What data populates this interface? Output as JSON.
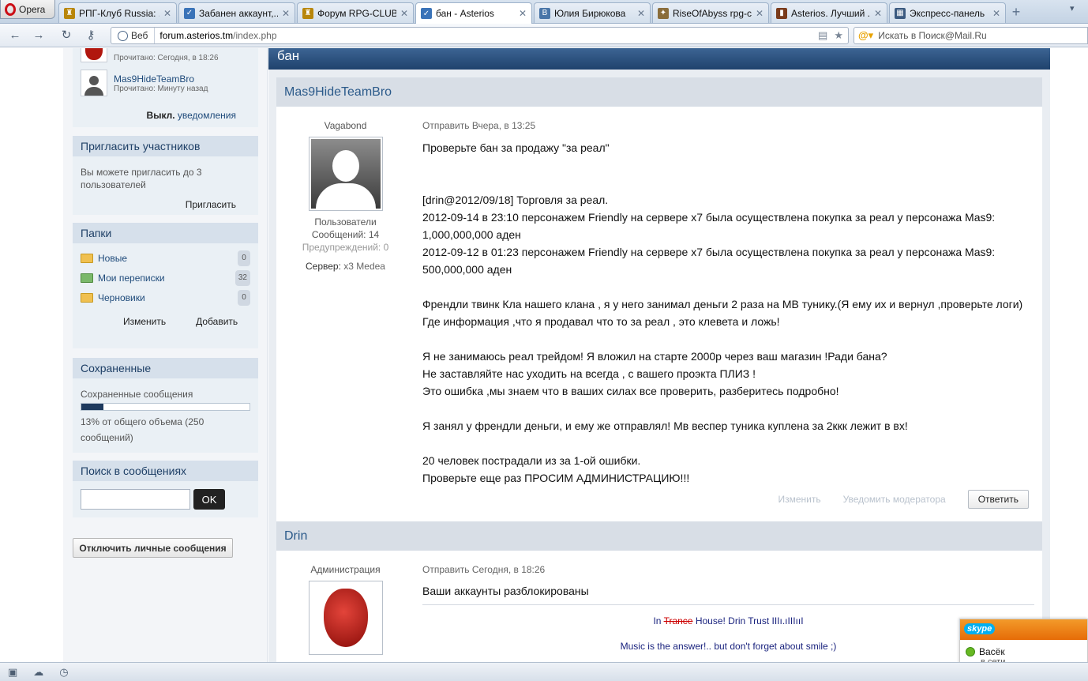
{
  "browser": {
    "opera_label": "Opera",
    "tabs": [
      {
        "title": "РПГ-Клуб Russia: ...",
        "favicon": "rpg-club-icon",
        "favcolor": "#b8860b"
      },
      {
        "title": "Забанен аккаунт,...",
        "favicon": "asterios-icon",
        "favcolor": "#3a73b8"
      },
      {
        "title": "Форум RPG-CLUB...",
        "favicon": "rpg-club-icon",
        "favcolor": "#b8860b"
      },
      {
        "title": "бан - Asterios",
        "favicon": "asterios-icon",
        "favcolor": "#3a73b8"
      },
      {
        "title": "Юлия Бирюкова",
        "favicon": "vk-icon",
        "favcolor": "#4a76a8"
      },
      {
        "title": "RiseOfAbyss rpg-c...",
        "favicon": "riseofabyss-icon",
        "favcolor": "#8a6d3b"
      },
      {
        "title": "Asterios. Лучший ...",
        "favicon": "asterios-book-icon",
        "favcolor": "#7a3b1b"
      },
      {
        "title": "Экспресс-панель",
        "favicon": "speed-dial-icon",
        "favcolor": "#3b5a80"
      }
    ],
    "web_label": "Веб",
    "url_domain": "forum.asterios.tm",
    "url_path": "/index.php",
    "search_placeholder": "Искать в Поиск@Mail.Ru"
  },
  "sidebar": {
    "readers": [
      {
        "name": "",
        "read": "Прочитано: Сегодня, в 18:26"
      },
      {
        "name": "Mas9HideTeamBro",
        "read": "Прочитано: Минуту назад"
      }
    ],
    "notifications_off": "Выкл.",
    "notifications_label": "уведомления",
    "invite": {
      "title": "Пригласить участников",
      "text": "Вы можете пригласить до 3 пользователей",
      "link": "Пригласить"
    },
    "folders": {
      "title": "Папки",
      "items": [
        {
          "name": "Новые",
          "count": "0"
        },
        {
          "name": "Мои переписки",
          "count": "32"
        },
        {
          "name": "Черновики",
          "count": "0"
        }
      ],
      "edit": "Изменить",
      "add": "Добавить"
    },
    "saved": {
      "title": "Сохраненные",
      "label": "Сохраненные сообщения",
      "usage_percent": 13,
      "usage_text": "13% от общего объема (250 сообщений)"
    },
    "search": {
      "title": "Поиск в сообщениях",
      "value": "",
      "ok": "OK"
    },
    "disable_pm": "Отключить личные сообщения"
  },
  "topic": {
    "title": "бан"
  },
  "posts": [
    {
      "author": "Mas9HideTeamBro",
      "rank": "Vagabond",
      "group": "Пользователи",
      "messages": "Сообщений: 14",
      "warnings": "Предупреждений: 0",
      "server_label": "Сервер:",
      "server": "x3 Medea",
      "sent": "Отправить Вчера, в 13:25",
      "lines": [
        "Проверьте бан за продажу \"за реал\"",
        "",
        "",
        "[drin@2012/09/18] Торговля за реал.",
        "2012-09-14 в 23:10 персонажем Friendly на сервере x7 была осуществлена покупка за реал у персонажа Mas9:",
        "1,000,000,000 аден",
        "2012-09-12 в 01:23 персонажем Friendly на сервере x7 была осуществлена покупка за реал у персонажа Mas9:",
        "500,000,000 аден",
        "",
        "Френдли твинк Кла нашего клана , я у него занимал деньги 2 раза на МВ тунику.(Я ему их и вернул ,проверьте логи)",
        "Где информация ,что я продавал что то за реал , это клевета и ложь!",
        "",
        "Я не занимаюсь реал трейдом! Я вложил на  старте 2000р через ваш магазин !Ради бана?",
        "Не заставляйте нас уходить на всегда , с вашего проэкта ПЛИЗ !",
        "Это ошибка ,мы знаем что в ваших силах все проверить, разберитесь подробно!",
        "",
        "Я занял у  френдли деньги, и ему же отправлял! Мв веспер туника куплена за 2ккк лежит в вх!",
        "",
        "20 человек пострадали из за 1-ой ошибки.",
        "Проверьте еще раз ПРОСИМ АДМИНИСТРАЦИЮ!!!"
      ],
      "edit": "Изменить",
      "report": "Уведомить модератора",
      "reply": "Ответить"
    },
    {
      "author": "Drin",
      "rank": "Администрация",
      "sent": "Отправить Сегодня, в 18:26",
      "text": "Ваши аккаунты разблокированы",
      "sig1_pre": "In ",
      "sig1_strike": "Trance",
      "sig1_post": " House! Drin Trust IIIı.ıIIIııI",
      "sig2": "Music is the answer!.. but don't forget about smile ;)"
    }
  ],
  "skype": {
    "logo": "skype",
    "contact": "Васёк",
    "status": "в сети"
  }
}
